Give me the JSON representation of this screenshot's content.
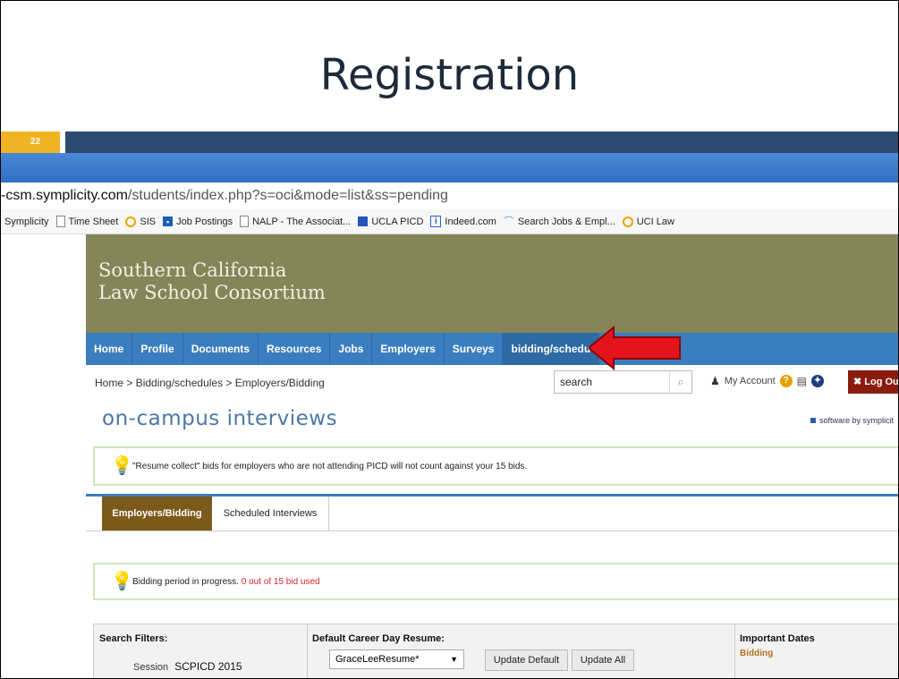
{
  "slide": {
    "title": "Registration",
    "number": "22",
    "colors": {
      "accent_gold": "#f0b323",
      "bar_navy": "#2c4a6e"
    }
  },
  "browser": {
    "url_host": "-csm.symplicity.com",
    "url_path": "/students/index.php?s=oci&mode=list&ss=pending",
    "bookmarks": [
      {
        "label": "Symplicity",
        "icon": "none"
      },
      {
        "label": "Time Sheet",
        "icon": "page-icon"
      },
      {
        "label": "SIS",
        "icon": "ring-icon"
      },
      {
        "label": "Job Postings",
        "icon": "app-icon"
      },
      {
        "label": "NALP - The Associat...",
        "icon": "page-icon"
      },
      {
        "label": "UCLA PICD",
        "icon": "blue-square-icon"
      },
      {
        "label": "Indeed.com",
        "icon": "info-icon"
      },
      {
        "label": "Search Jobs & Empl...",
        "icon": "wave-icon"
      },
      {
        "label": "UCI Law",
        "icon": "ring-icon"
      }
    ]
  },
  "site": {
    "banner_line1": "Southern California",
    "banner_line2": "Law School Consortium",
    "nav": [
      "Home",
      "Profile",
      "Documents",
      "Resources",
      "Jobs",
      "Employers",
      "Surveys",
      "bidding/schedu"
    ],
    "breadcrumb": "Home > Bidding/schedules > Employers/Bidding",
    "search_value": "search",
    "my_account": "My Account",
    "logout": "Log Ou",
    "page_heading": "on-campus interviews",
    "software_by": "software by symplicit",
    "notice1": "\"Resume collect\" bids for employers who are not attending PICD will not count against your 15 bids.",
    "tabs": [
      "Employers/Bidding",
      "Scheduled Interviews"
    ],
    "notice2_prefix": "Bidding period in progress.",
    "notice2_count": "0 out of 15 bid used",
    "filters_label": "Search Filters:",
    "session_label": "Session",
    "session_value": "SCPICD 2015",
    "resume_label": "Default Career Day Resume:",
    "resume_value": "GraceLeeResume*",
    "update_default": "Update Default",
    "update_all": "Update All",
    "important_dates": "Important Dates",
    "bidding_label": "Bidding"
  }
}
